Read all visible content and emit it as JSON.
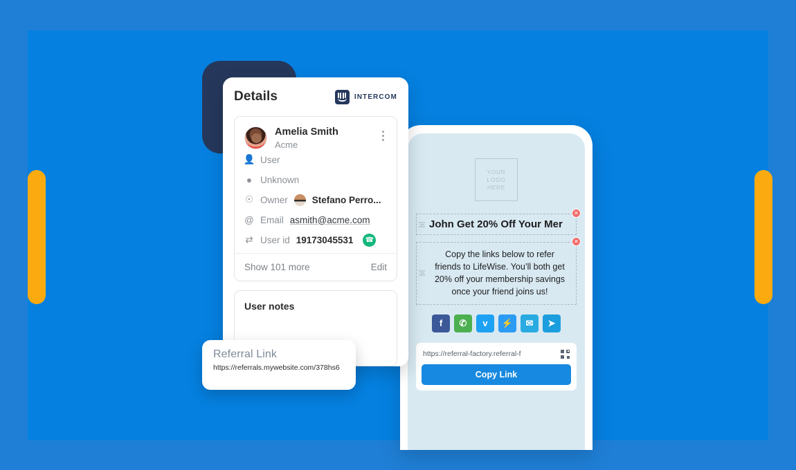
{
  "theme": {
    "outer_blue": "#1f7fd6",
    "inner_blue": "#0580e0",
    "accent_orange": "#fbab10",
    "navy": "#25385c",
    "green": "#14b87c",
    "cta_blue": "#1789e0",
    "delete_red": "#f06a6a"
  },
  "details_panel": {
    "title": "Details",
    "brand": "INTERCOM",
    "person": {
      "name": "Amelia Smith",
      "company": "Acme"
    },
    "rows": [
      {
        "icon": "user-icon",
        "label": "User",
        "value": ""
      },
      {
        "icon": "location-icon",
        "label": "Unknown",
        "value": ""
      },
      {
        "icon": "owner-icon",
        "label": "Owner",
        "value": "Stefano Perro..."
      },
      {
        "icon": "at-icon",
        "label": "Email",
        "value": "asmith@acme.com"
      },
      {
        "icon": "shuffle-icon",
        "label": "User id",
        "value": "19173045531"
      }
    ],
    "show_more": "Show 101 more",
    "edit": "Edit",
    "notes_title": "User notes"
  },
  "phone": {
    "logo_placeholder": [
      "YOUR",
      "LOGO",
      "HERE"
    ],
    "headline": "John Get 20% Off Your Mer",
    "body": "Copy the links below to refer friends to LifeWise. You’ll both get 20% off your membership savings once your friend joins us!",
    "socials": [
      {
        "name": "facebook-share-button",
        "glyph": "f",
        "color": "#3b5998"
      },
      {
        "name": "whatsapp-share-button",
        "glyph": "✆",
        "color": "#4caf50"
      },
      {
        "name": "twitter-share-button",
        "glyph": "ᴠ",
        "color": "#1da1f2"
      },
      {
        "name": "messenger-share-button",
        "glyph": "⚡",
        "color": "#2b9bf4"
      },
      {
        "name": "email-share-button",
        "glyph": "✉",
        "color": "#29abe2"
      },
      {
        "name": "telegram-share-button",
        "glyph": "➤",
        "color": "#1c9ede"
      }
    ],
    "link_value": "https://referral-factory.referral-f",
    "copy_label": "Copy Link"
  },
  "referral_card": {
    "title": "Referral Link",
    "url": "https://referrals.mywebsite.com/378hs6"
  }
}
